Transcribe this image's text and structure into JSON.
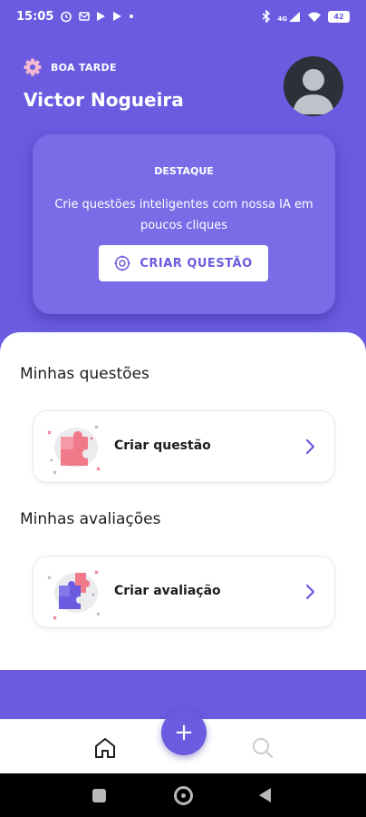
{
  "status_bar": {
    "time": "15:05",
    "network": "4G",
    "battery": "42"
  },
  "header": {
    "greeting": "BOA TARDE",
    "user_name": "Victor Nogueira"
  },
  "highlight": {
    "label": "DESTAQUE",
    "text": "Crie questões inteligentes com nossa IA em poucos cliques",
    "button_label": "CRIAR QUESTÃO"
  },
  "sections": {
    "questions": {
      "title": "Minhas questões",
      "card_label": "Criar questão"
    },
    "evaluations": {
      "title": "Minhas avaliações",
      "card_label": "Criar avaliação"
    }
  },
  "bottom_nav": {
    "fab_label": "+",
    "icons": [
      "home-icon",
      "search-icon"
    ]
  },
  "colors": {
    "primary": "#6a5be0",
    "card_purple": "#7a6be6",
    "accent_pink": "#f07a8a"
  }
}
